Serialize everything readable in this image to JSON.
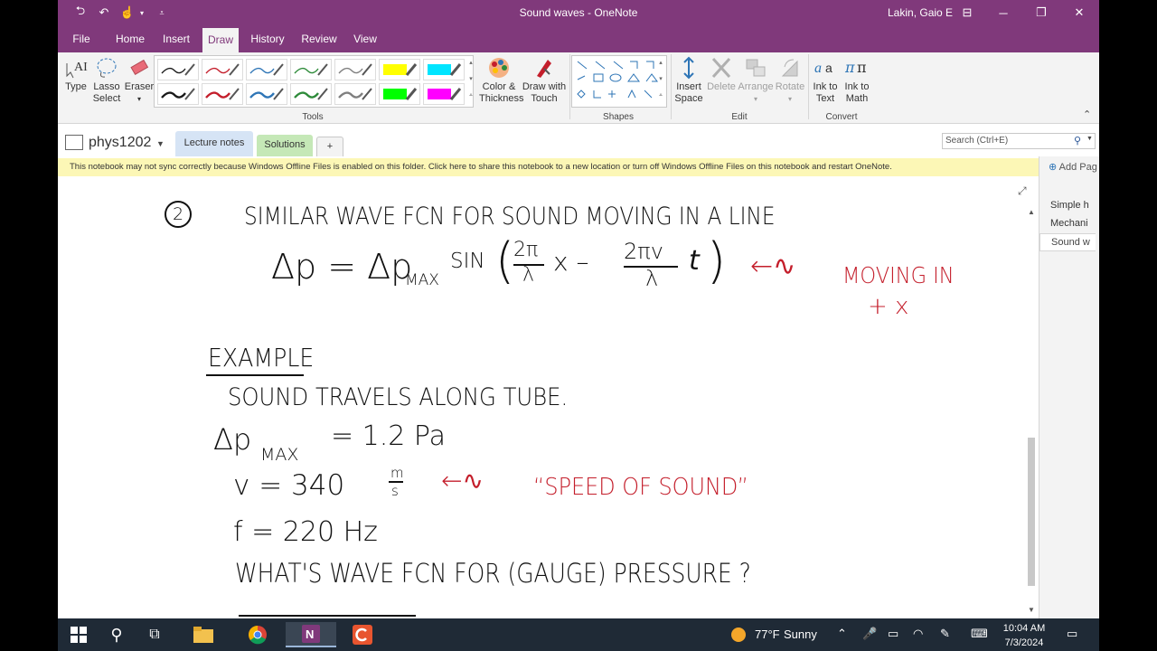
{
  "window": {
    "title": "Sound waves  -  OneNote",
    "user": "Lakin, Gaio E"
  },
  "tabs": [
    "File",
    "Home",
    "Insert",
    "Draw",
    "History",
    "Review",
    "View"
  ],
  "active_tab": "Draw",
  "ribbon": {
    "type_label": "Type",
    "lasso_label": "Lasso Select",
    "eraser_label": "Eraser",
    "color_thickness_label": "Color & Thickness",
    "draw_touch_label": "Draw with Touch",
    "insert_space_label": "Insert Space",
    "delete_label": "Delete",
    "arrange_label": "Arrange",
    "rotate_label": "Rotate",
    "ink_text_label": "Ink to Text",
    "ink_math_label": "Ink to Math",
    "groups": {
      "tools": "Tools",
      "shapes": "Shapes",
      "edit": "Edit",
      "convert": "Convert"
    },
    "pen_colors": [
      "#1a1a1a",
      "#c41e2b",
      "#2e75b6",
      "#2e8b3a",
      "#7f7f7f",
      "#ffff00",
      "#00e5ff",
      "#1a1a1a",
      "#c41e2b",
      "#2e75b6",
      "#2e8b3a",
      "#7f7f7f",
      "#00ff00",
      "#ff00ff"
    ]
  },
  "notebook": {
    "name": "phys1202",
    "sections": [
      {
        "label": "Lecture notes",
        "color": "#d6e4f5"
      },
      {
        "label": "Solutions",
        "color": "#c5e8b7"
      },
      {
        "label": "+",
        "color": "#f3f3f3"
      }
    ],
    "search_placeholder": "Search (Ctrl+E)"
  },
  "banner": "This notebook may not sync correctly because Windows Offline Files is enabled on this folder. Click here to share this notebook to a new location or turn off Windows Offline Files on this notebook and restart OneNote.",
  "pages_pane": {
    "add_page": "Add Pag",
    "pages": [
      "Simple h",
      "Mechani",
      "Sound w"
    ],
    "selected": 2
  },
  "ink": {
    "num": "2",
    "line1": "SIMILAR   WAVE   FCN     FOR    SOUND    MOVING    IN    A    LINE",
    "eq_lhs": "Δp  =  Δp",
    "eq_sub": "MAX",
    "eq_sin": "SIN",
    "eq_open": "(",
    "eq_num1": "2π",
    "eq_den1": "λ",
    "eq_x": "x  –",
    "eq_num2": "2πv",
    "eq_den2": "λ",
    "eq_t": "t",
    "eq_close": ")",
    "arrow1": "←∿",
    "note1a": "MOVING   IN",
    "note1b": "+ x",
    "example": "EXAMPLE",
    "line2": "SOUND    TRAVELS    ALONG    TUBE.",
    "dp_label": "Δp",
    "dp_sub": "MAX",
    "dp_val": "=   1.2   Pa",
    "v_label": "v   =   340",
    "v_unit_num": "m",
    "v_unit_den": "s",
    "arrow2": "←∿",
    "note2": "“SPEED    OF    SOUND”",
    "f_line": "f   =   220  Hz",
    "q_line": "WHAT'S    WAVE    FCN    FOR    (GAUGE)    PRESSURE ?"
  },
  "taskbar": {
    "weather_temp": "77°F",
    "weather_desc": "Sunny",
    "time": "10:04 AM",
    "date": "7/3/2024"
  }
}
